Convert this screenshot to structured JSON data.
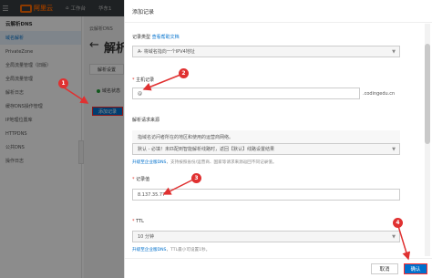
{
  "topbar": {
    "logo_text": "阿里云",
    "workbench": "工作台",
    "region": "华东1"
  },
  "sidebar": {
    "title": "云解析DNS",
    "items": [
      {
        "label": "域名解析"
      },
      {
        "label": "PrivateZone"
      },
      {
        "label": "全局流量管理（旧版）"
      },
      {
        "label": "全局流量管理"
      },
      {
        "label": "解析日志"
      },
      {
        "label": "缓存DNS操作管理"
      },
      {
        "label": "IP地理位置库"
      },
      {
        "label": "HTTPDNS"
      },
      {
        "label": "公共DNS"
      },
      {
        "label": "操作日志"
      }
    ]
  },
  "main": {
    "breadcrumb": "云解析DNS",
    "title": "解析",
    "tab_label": "解析设置",
    "status_text": "域名状态",
    "add_record_button": "添加记录"
  },
  "drawer": {
    "title": "添加记录",
    "record_type_label": "记录类型",
    "help_link": "查看帮助文档",
    "record_type_value": "A- 将域名指向一个IPV4地址",
    "host_label": "主机记录",
    "host_value": "@",
    "host_suffix": ".codingedu.cn",
    "line_label": "解析请求来源",
    "info_text": "指域名访问者所在的地区和使用的运营商网络。",
    "line_value": "默认 - 必填！未匹配到智能解析线路时，返回【默认】线路设置结果",
    "upgrade_link_1": "升级至企业版DNS",
    "upgrade_hint_1": "，支持按照省份/运营商、国家等请求来源返回不同记录值。",
    "value_label": "记录值",
    "value_value": "8.137.35.77",
    "ttl_label": "TTL",
    "ttl_value": "10 分钟",
    "upgrade_link_2": "升级至企业版DNS",
    "upgrade_hint_2": "，TTL最小可设置1秒。",
    "cancel_button": "取消",
    "ok_button": "确认"
  },
  "markers": [
    "1",
    "2",
    "3",
    "4"
  ],
  "colors": {
    "accent": "#0070cc",
    "marker": "#e03131",
    "topbar": "#373d41",
    "brand": "#ff6a00"
  }
}
